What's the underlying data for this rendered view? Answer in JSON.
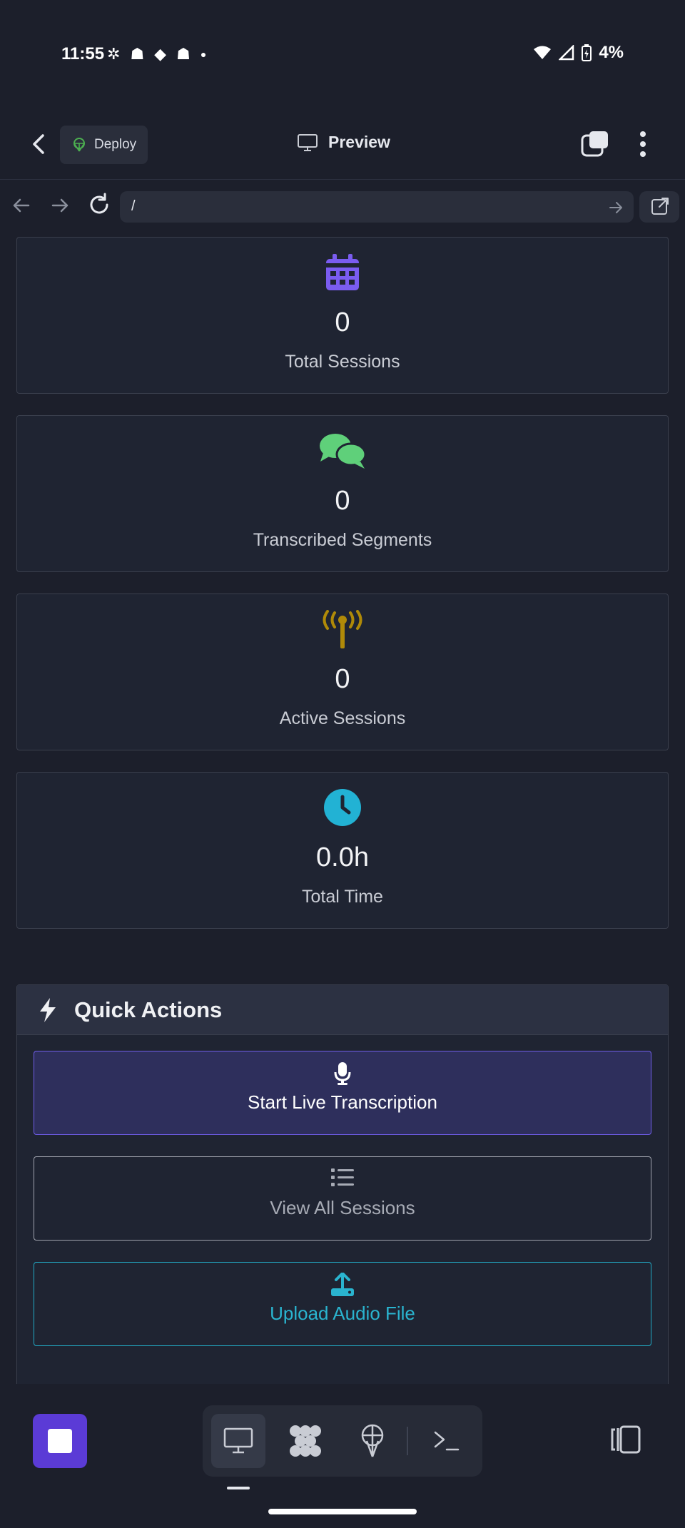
{
  "status_bar": {
    "time": "11:55",
    "battery": "4%",
    "notification_icons": [
      "slack-icon",
      "snapchat-icon",
      "messaging-icon",
      "snapchat-icon",
      "dot-icon"
    ]
  },
  "app_bar": {
    "deploy_label": "Deploy",
    "title": "Preview"
  },
  "browser": {
    "url": "/"
  },
  "stats": [
    {
      "icon": "calendar-icon",
      "value": "0",
      "label": "Total Sessions",
      "color": "#7a5cf0"
    },
    {
      "icon": "chat-bubbles-icon",
      "value": "0",
      "label": "Transcribed Segments",
      "color": "#5fd07a"
    },
    {
      "icon": "broadcast-tower-icon",
      "value": "0",
      "label": "Active Sessions",
      "color": "#b08a08"
    },
    {
      "icon": "clock-icon",
      "value": "0.0h",
      "label": "Total Time",
      "color": "#22b2d4"
    }
  ],
  "quick_actions": {
    "title": "Quick Actions",
    "buttons": [
      {
        "icon": "microphone-icon",
        "label": "Start Live Transcription"
      },
      {
        "icon": "list-icon",
        "label": "View All Sessions"
      },
      {
        "icon": "upload-icon",
        "label": "Upload Audio File"
      }
    ]
  },
  "colors": {
    "background": "#1c1f2b",
    "card": "#1f2432",
    "accent": "#6f5de8",
    "info": "#22a9c4"
  }
}
